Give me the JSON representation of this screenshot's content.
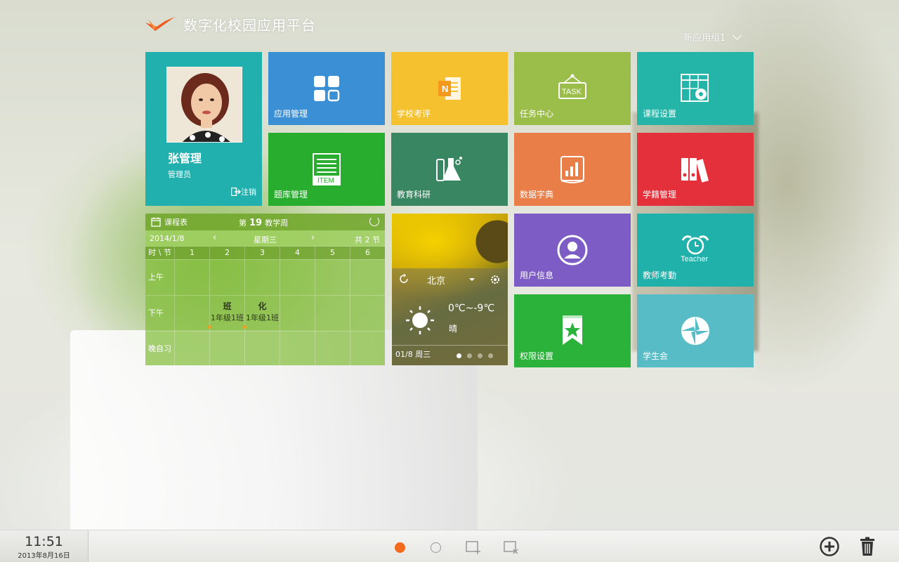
{
  "header": {
    "app_title": "数字化校园应用平台",
    "group_label": "新应用组1"
  },
  "user": {
    "name": "张管理",
    "role": "管理员",
    "logout_label": "注销"
  },
  "tiles": [
    {
      "label": "应用管理",
      "color": "#3b8fd4",
      "icon": "grid-icon"
    },
    {
      "label": "学校考评",
      "color": "#f5c12e",
      "icon": "notebook-icon"
    },
    {
      "label": "任务中心",
      "color": "#9bbd4a",
      "icon": "task-board-icon"
    },
    {
      "label": "课程设置",
      "color": "#24b4a8",
      "icon": "calendar-gear-icon"
    },
    {
      "label": "题库管理",
      "color": "#28ad2e",
      "icon": "item-list-icon"
    },
    {
      "label": "教育科研",
      "color": "#398662",
      "icon": "lab-flask-icon"
    },
    {
      "label": "数据字典",
      "color": "#ea7e48",
      "icon": "chart-book-icon"
    },
    {
      "label": "学籍管理",
      "color": "#e3303b",
      "icon": "binders-icon"
    },
    {
      "label": "用户信息",
      "color": "#7e5cc6",
      "icon": "user-circle-icon"
    },
    {
      "label": "教师考勤",
      "color": "#20b1ab",
      "icon": "alarm-clock-icon"
    },
    {
      "label": "权限设置",
      "color": "#2ab23a",
      "icon": "bookmark-star-icon"
    },
    {
      "label": "学生会",
      "color": "#58bcc6",
      "icon": "aperture-icon"
    }
  ],
  "teacher_icon_text": "Teacher",
  "task_icon_text": "TASK",
  "item_icon_text": "ITEM",
  "schedule": {
    "title": "课程表",
    "week_prefix": "第",
    "week_number": "19",
    "week_suffix": "教学周",
    "date": "2014/1/8",
    "weekday": "星期三",
    "total": "共 2 节",
    "corner_header": "时 \\ 节",
    "periods": [
      "1",
      "2",
      "3",
      "4",
      "5",
      "6"
    ],
    "rows": [
      {
        "label": "上午",
        "cells": [
          null,
          null,
          null,
          null,
          null,
          null
        ]
      },
      {
        "label": "下午",
        "cells": [
          null,
          {
            "subject": "班",
            "class": "1年级1班"
          },
          {
            "subject": "化",
            "class": "1年级1班"
          },
          null,
          null,
          null
        ]
      },
      {
        "label": "晚自习",
        "cells": [
          null,
          null,
          null,
          null,
          null,
          null
        ]
      }
    ]
  },
  "weather": {
    "city": "北京",
    "temperature": "0℃~-9℃",
    "condition": "晴",
    "date": "01/8 周三",
    "page_count": 4,
    "active_page": 1
  },
  "taskbar": {
    "time": "11:51",
    "date": "2013年8月16日",
    "pages": 2,
    "active_page": 1
  },
  "colors": {
    "accent": "#f26b1d",
    "user_tile": "#21b0ae"
  }
}
